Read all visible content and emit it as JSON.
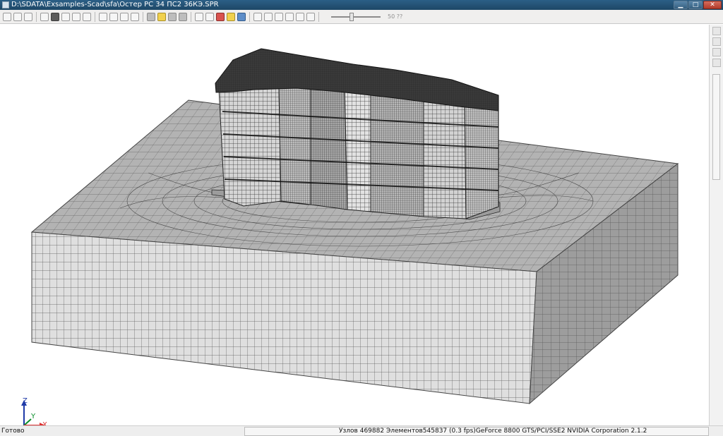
{
  "window": {
    "title": "D:\\SDATA\\Exsamples-Scad\\sfa\\Остер РС 34 ПС2 36КЭ.SPR",
    "minimize": "▁",
    "maximize": "□",
    "close": "✕"
  },
  "toolbar": {
    "icons": [
      "zoom-in-icon",
      "zoom-out-icon",
      "zoom-window-icon",
      "zoom-fit-icon",
      "rotate-icon",
      "pan-icon",
      "select-icon",
      "perspective-icon",
      "projection-icon",
      "print-icon",
      "export-icon",
      "filter-icon",
      "model-icon",
      "node-icon",
      "element-icon",
      "fill-icon",
      "marker-icon",
      "grid-icon",
      "pen-icon",
      "colors-icon"
    ],
    "slider_value": "50 ??"
  },
  "viewport": {
    "axis_labels": {
      "z": "Z",
      "y": "Y",
      "x": "X"
    },
    "colors": {
      "soil_top": "#b3b3b3",
      "soil_front": "#dfdfdf",
      "soil_side": "#9d9d9d",
      "mesh": "#2f2f2f",
      "building_dark": "#3c3c3c"
    }
  },
  "status": {
    "ready": "Готово",
    "nodes_label": "Узлов",
    "nodes_value": "469882",
    "elements_label": "Элементов",
    "elements_value": "545837",
    "fps": "(0.3 fps)",
    "renderer": "GeForce 8800 GTS/PCI/SSE2 NVIDIA Corporation 2.1.2"
  }
}
